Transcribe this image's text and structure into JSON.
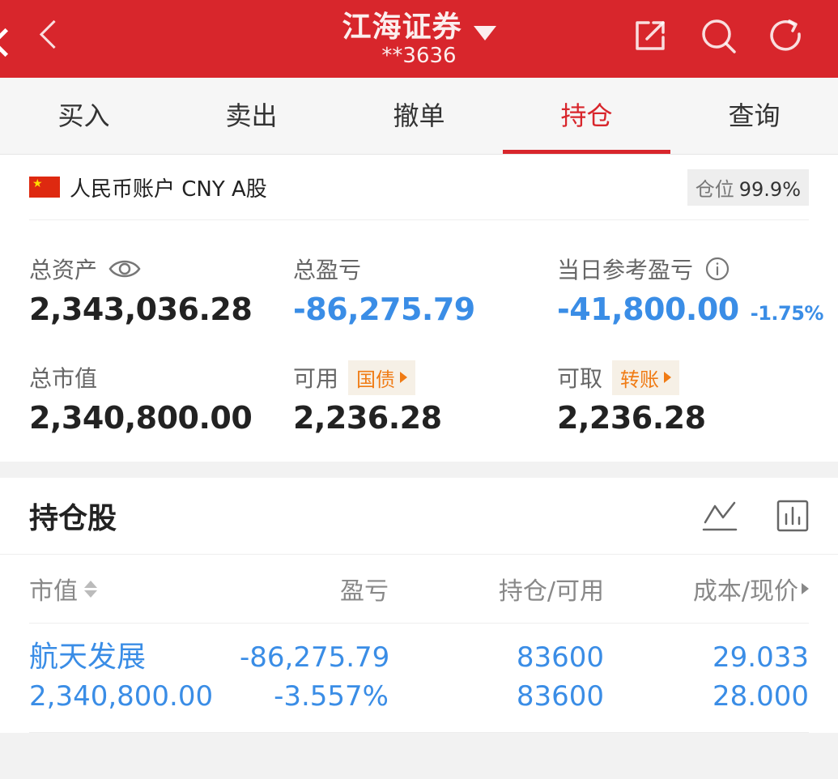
{
  "header": {
    "broker_name": "江海证券",
    "account_masked": "**3636",
    "icons": [
      "back-icon",
      "share-icon",
      "search-icon",
      "refresh-icon"
    ]
  },
  "tabs": [
    {
      "label": "买入",
      "active": false
    },
    {
      "label": "卖出",
      "active": false
    },
    {
      "label": "撤单",
      "active": false
    },
    {
      "label": "持仓",
      "active": true
    },
    {
      "label": "查询",
      "active": false
    }
  ],
  "account": {
    "label": "人民币账户 CNY A股",
    "position_label": "仓位",
    "position_value": "99.9%"
  },
  "metrics": {
    "total_assets": {
      "label": "总资产",
      "value": "2,343,036.28"
    },
    "total_pnl": {
      "label": "总盈亏",
      "value": "-86,275.79"
    },
    "daily_pnl": {
      "label": "当日参考盈亏",
      "value": "-41,800.00",
      "pct": "-1.75%"
    },
    "market_value": {
      "label": "总市值",
      "value": "2,340,800.00"
    },
    "available": {
      "label": "可用",
      "tag": "国债",
      "value": "2,236.28"
    },
    "withdrawable": {
      "label": "可取",
      "tag": "转账",
      "value": "2,236.28"
    }
  },
  "holdings": {
    "title": "持仓股",
    "columns": [
      "市值",
      "盈亏",
      "持仓/可用",
      "成本/现价"
    ],
    "rows": [
      {
        "name": "航天发展",
        "market_value": "2,340,800.00",
        "pnl": "-86,275.79",
        "pnl_pct": "-3.557%",
        "position": "83600",
        "available": "83600",
        "cost": "29.033",
        "price": "28.000"
      }
    ]
  },
  "colors": {
    "brand_red": "#d8262c",
    "loss_blue": "#3a8de6",
    "tag_orange": "#f07b14"
  }
}
